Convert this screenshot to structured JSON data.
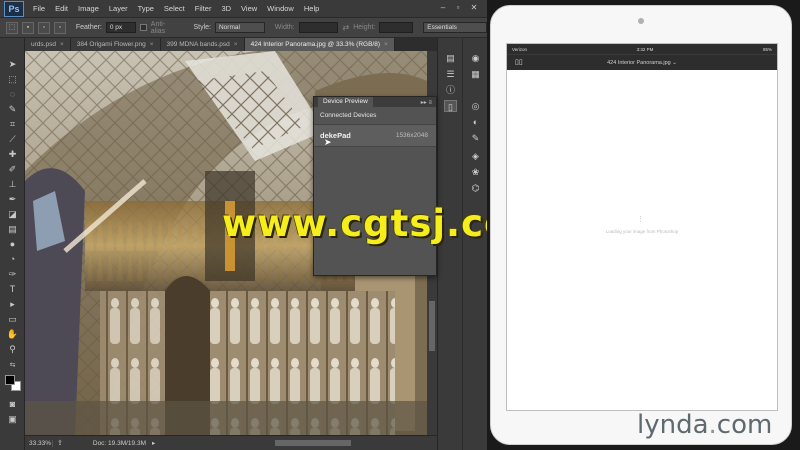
{
  "menubar": {
    "logo": "Ps",
    "items": [
      "File",
      "Edit",
      "Image",
      "Layer",
      "Type",
      "Select",
      "Filter",
      "3D",
      "View",
      "Window",
      "Help"
    ]
  },
  "options": {
    "feather_label": "Feather:",
    "feather_value": "0 px",
    "antialias_label": "Anti-alias",
    "style_label": "Style:",
    "style_value": "Normal",
    "width_label": "Width:",
    "height_label": "Height:",
    "workspace_value": "Essentials"
  },
  "tabs": [
    {
      "label": "urds.psd"
    },
    {
      "label": "384 Origami Flower.png"
    },
    {
      "label": "399 MDNA bands.psd"
    },
    {
      "label": "424 Interior Panorama.jpg @ 33.3% (RGB/8)"
    }
  ],
  "status": {
    "zoom": "33.33%",
    "doc": "Doc: 19.3M/19.3M"
  },
  "device_preview": {
    "tab": "Device Preview",
    "section": "Connected Devices",
    "device_name": "dekePad",
    "device_resolution": "1536x2048"
  },
  "watermark": "www.cgtsj.com",
  "ipad": {
    "carrier": "Verizon",
    "time": "3:32 PM",
    "battery": "85%",
    "doc_title": "424 Interior Panorama.jpg",
    "loading_text": "Loading your image from Photoshop"
  },
  "branding": {
    "name": "lynda",
    "tld": "com"
  },
  "colors": {
    "watermark": "#f6ee1c",
    "ps_background": "#383838",
    "active_tab": "#5a5a5a"
  }
}
